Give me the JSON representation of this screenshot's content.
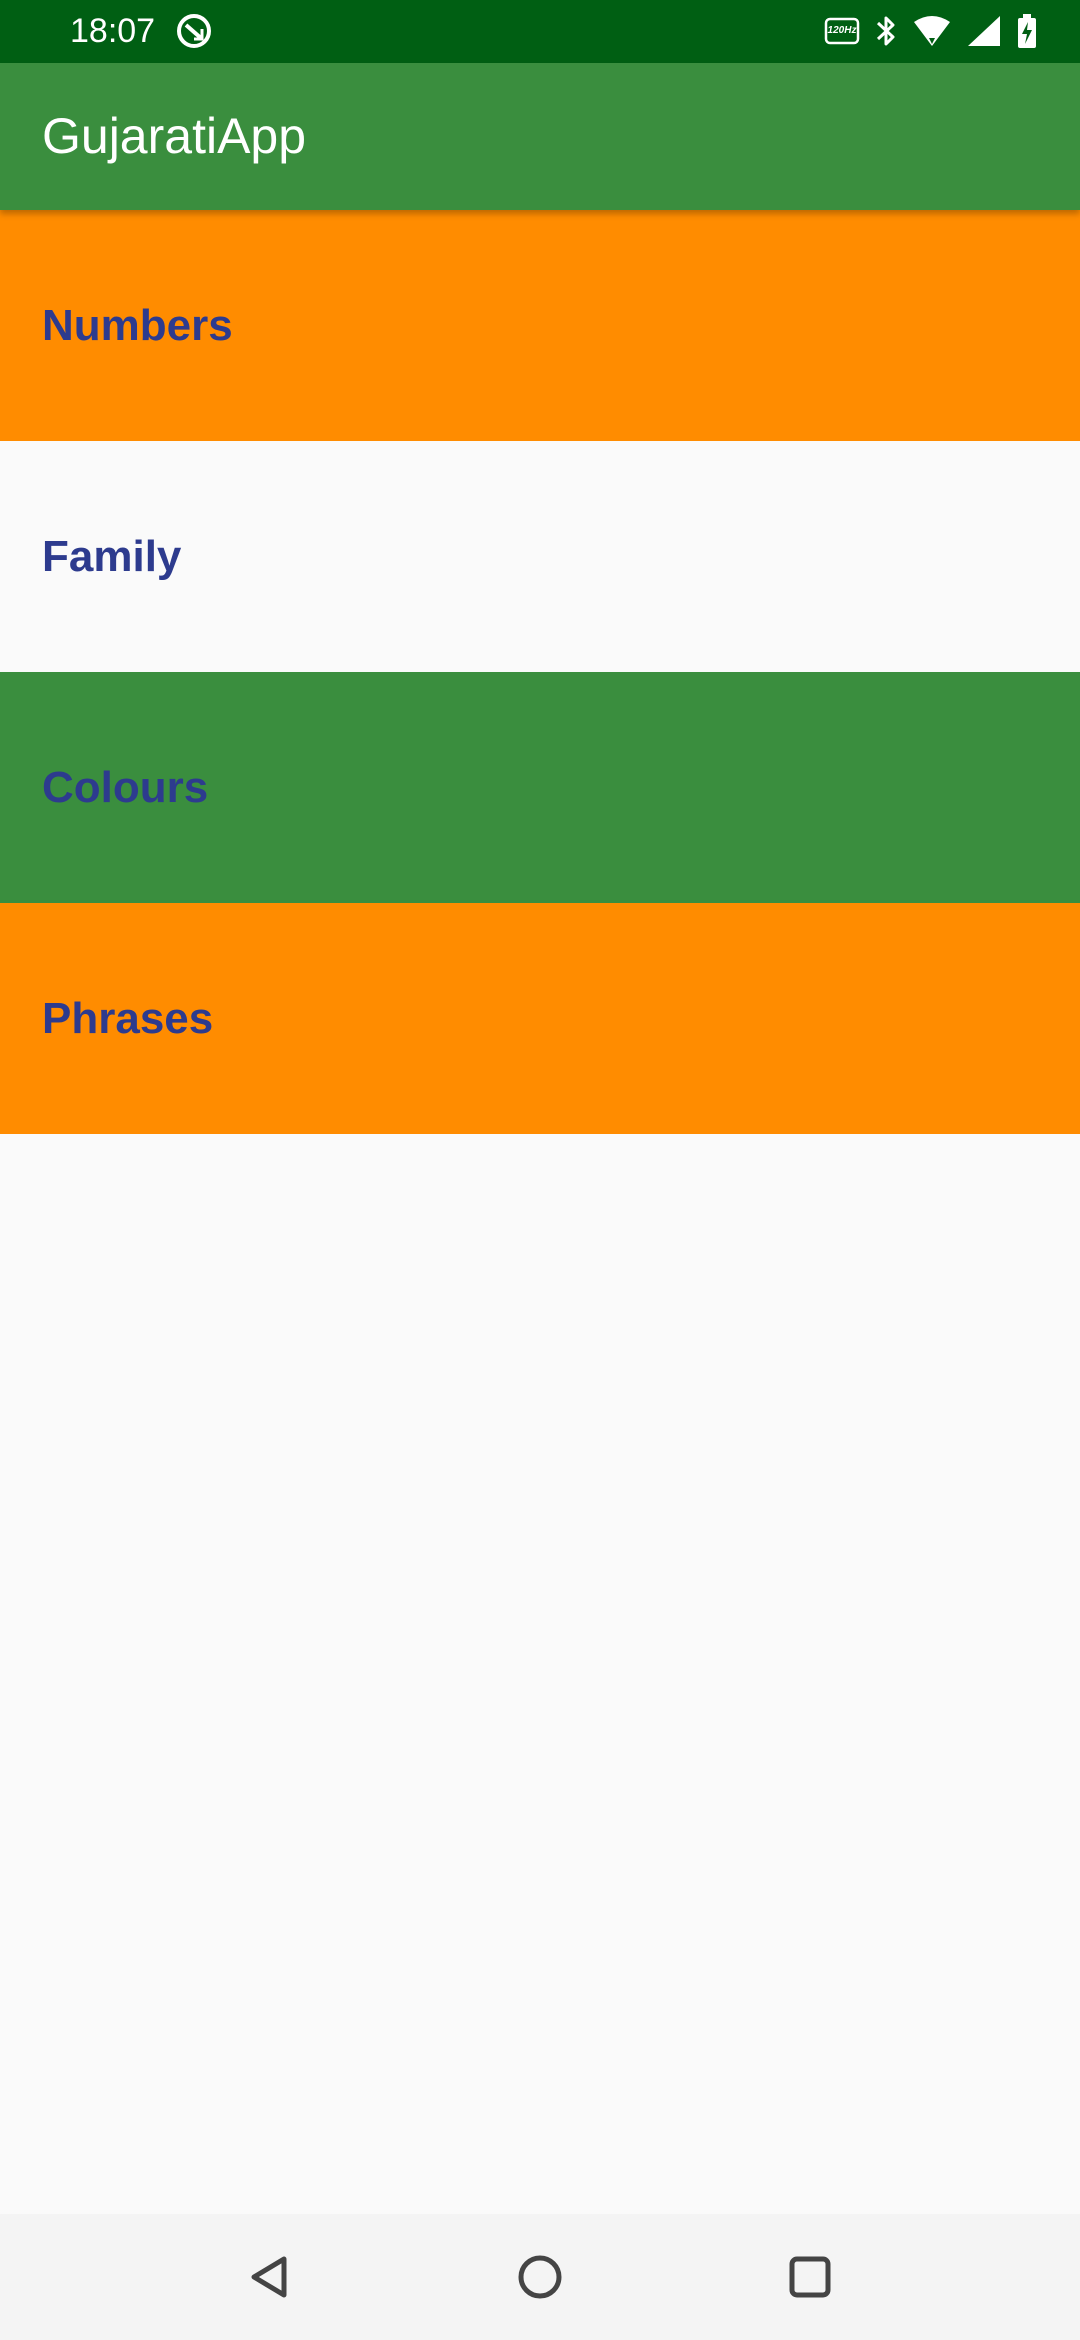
{
  "status_bar": {
    "time": "18:07",
    "background": "#005f13",
    "icons": [
      "data-saver-icon",
      "refresh-rate-icon",
      "bluetooth-icon",
      "wifi-icon",
      "cellular-signal-icon",
      "battery-charging-icon"
    ],
    "refresh_rate_label": "120Hz"
  },
  "app_bar": {
    "title": "GujaratiApp",
    "background": "#3a8e3e"
  },
  "categories": [
    {
      "label": "Numbers",
      "color": "#ff8c00"
    },
    {
      "label": "Family",
      "color": "#fafafa"
    },
    {
      "label": "Colours",
      "color": "#3a8e3e"
    },
    {
      "label": "Phrases",
      "color": "#ff8c00"
    }
  ],
  "label_color": "#2d3b8e",
  "nav_bar": {
    "buttons": [
      "back-icon",
      "home-icon",
      "recents-icon"
    ]
  }
}
